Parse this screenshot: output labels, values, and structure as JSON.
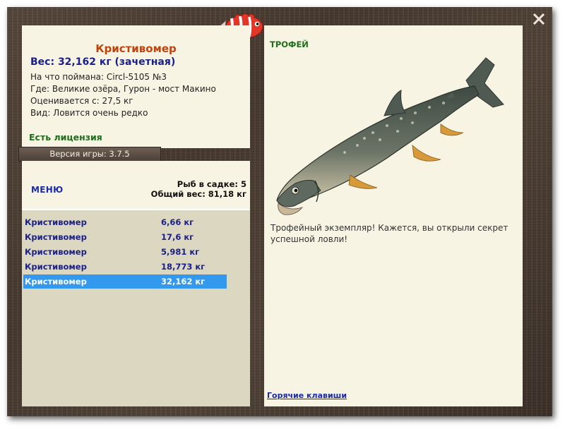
{
  "window": {
    "close_icon": "close-x-icon",
    "logo_icon": "red-fish-logo-icon"
  },
  "info": {
    "fish_name": "Кристивомер",
    "weight": "Вес: 32,162 кг (зачетная)",
    "caught_on": "На что поймана: Circl-5105 №3",
    "location": "Где: Великие озёра, Гурон - мост Макино",
    "rated_from": "Оценивается с: 27,5 кг",
    "rarity": "Вид: Ловится очень редко",
    "license": "Есть лицензия"
  },
  "version": {
    "label": "Версия игры:",
    "number": "3.7.5"
  },
  "list_header": {
    "menu_label": "меню",
    "fish_count": "Рыб в садке: 5",
    "total_weight": "Общий вес: 81,18 кг"
  },
  "catch_list": [
    {
      "name": "Кристивомер",
      "weight": "6,66 кг"
    },
    {
      "name": "Кристивомер",
      "weight": "17,6 кг"
    },
    {
      "name": "Кристивомер",
      "weight": "5,981 кг"
    },
    {
      "name": "Кристивомер",
      "weight": "18,773 кг"
    },
    {
      "name": "Кристивомер",
      "weight": "32,162 кг"
    }
  ],
  "selected_index": 4,
  "trophy": {
    "label": "ТРОФЕЙ",
    "image_icon": "lake-trout-fish-image",
    "description": "Трофейный экземпляр! Кажется, вы открыли секрет успешной ловли!",
    "hotkeys": "Горячие клавиши"
  },
  "colors": {
    "fish_name": "#c0430c",
    "weight": "#1a2088",
    "license": "#1e6e1e",
    "selected_row": "#3399ee",
    "panel_bg": "#f8f4e3",
    "frame_wood": "#4a3c32"
  }
}
